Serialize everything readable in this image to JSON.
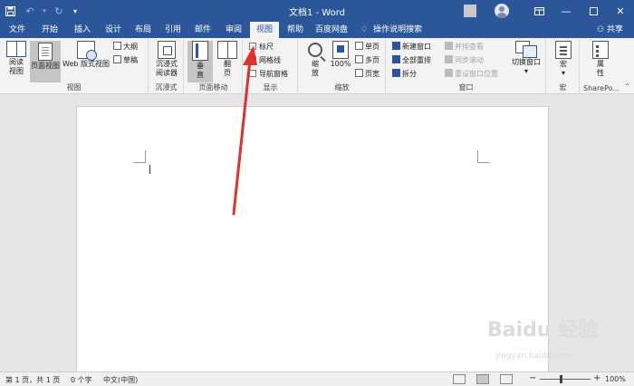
{
  "window": {
    "title": "文档1 - Word"
  },
  "tabs": [
    {
      "label": "文件"
    },
    {
      "label": "开始"
    },
    {
      "label": "插入"
    },
    {
      "label": "设计"
    },
    {
      "label": "布局"
    },
    {
      "label": "引用"
    },
    {
      "label": "邮件"
    },
    {
      "label": "审阅"
    },
    {
      "label": "视图"
    },
    {
      "label": "帮助"
    },
    {
      "label": "百度网盘"
    }
  ],
  "active_tab": "视图",
  "tell_me": "操作说明搜索",
  "share_label": "共享",
  "ribbon": {
    "views": {
      "label": "视图",
      "read_mode": "阅读\n视图",
      "print_layout": "页面视图",
      "web_layout": "Web 版式视图",
      "outline": "大纲",
      "draft": "草稿"
    },
    "immersive": {
      "label": "沉浸式",
      "reader": "沉浸式\n阅读器"
    },
    "page_movement": {
      "label": "页面移动",
      "vertical": "垂\n直",
      "side_to_side": "翻\n页"
    },
    "show": {
      "label": "显示",
      "ruler": "标尺",
      "gridlines": "网格线",
      "navigation_pane": "导航窗格"
    },
    "zoom": {
      "label": "缩放",
      "zoom": "缩\n放",
      "hundred": "100%",
      "one_page": "单页",
      "multiple_pages": "多页",
      "page_width": "页宽"
    },
    "window": {
      "label": "窗口",
      "new_window": "新建窗口",
      "arrange_all": "全部重排",
      "split": "拆分",
      "view_side_by_side": "并排查看",
      "synchronous_scrolling": "同步滚动",
      "reset_window_position": "重设窗口位置",
      "switch_windows": "切换窗口"
    },
    "macros": {
      "label": "宏",
      "macros": "宏"
    },
    "sharepoint": {
      "label": "SharePo...",
      "properties": "属\n性"
    }
  },
  "status": {
    "page": "第 1 页，共 1 页",
    "words": "0 个字",
    "language": "中文(中国)",
    "zoom": "100%"
  },
  "watermark": {
    "logo": "Baidu 经验",
    "url": "jingyan.baidu.com"
  },
  "colors": {
    "accent": "#2b579a",
    "arrow": "#e0312a"
  }
}
